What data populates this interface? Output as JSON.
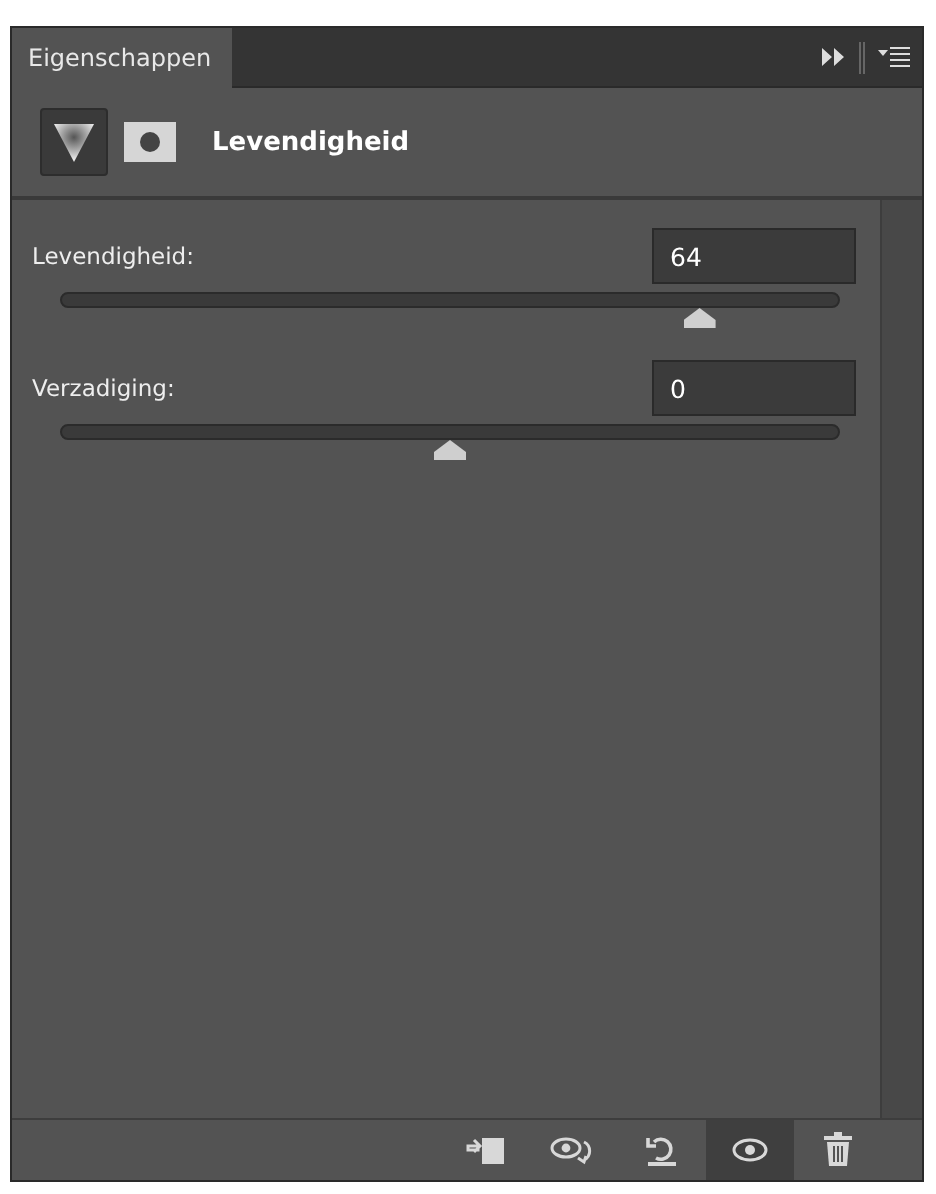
{
  "tab": {
    "label": "Eigenschappen",
    "selected": true
  },
  "header": {
    "title": "Levendigheid"
  },
  "sliders": [
    {
      "label": "Levendigheid:",
      "value": "64",
      "level": 0.82
    },
    {
      "label": "Verzadiging:",
      "value": "0",
      "level": 0.5
    }
  ],
  "toolbar": [
    {
      "kind": "clip",
      "selected": false
    },
    {
      "kind": "view-previous",
      "selected": false
    },
    {
      "kind": "reset",
      "selected": false
    },
    {
      "kind": "visibility",
      "selected": true
    },
    {
      "kind": "delete",
      "selected": false
    }
  ]
}
